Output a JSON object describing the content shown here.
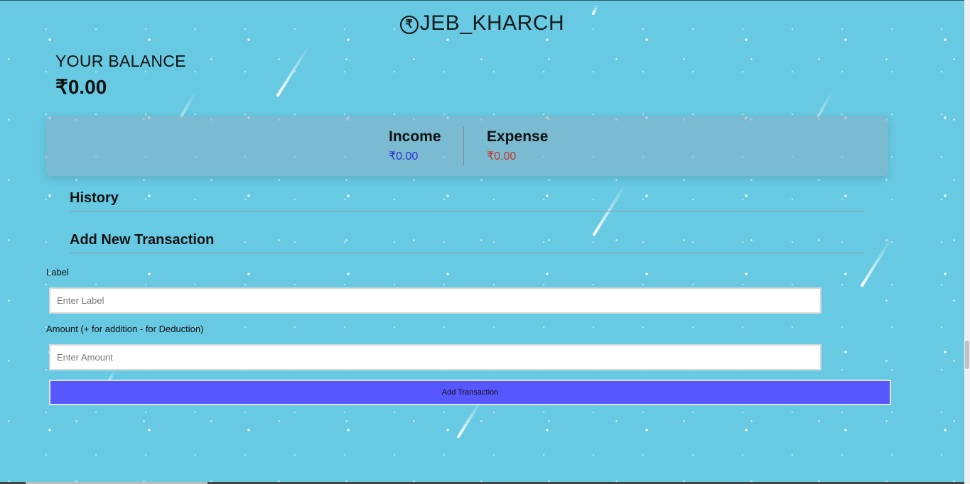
{
  "app": {
    "brand_icon": "₹",
    "brand_icon_name": "rupee-coin-icon",
    "title": "JEB_KHARCH"
  },
  "balance": {
    "label": "YOUR BALANCE",
    "value": "₹0.00"
  },
  "summary": {
    "income_label": "Income",
    "income_value": "₹0.00",
    "expense_label": "Expense",
    "expense_value": "₹0.00"
  },
  "sections": {
    "history": "History",
    "add_new": "Add New Transaction"
  },
  "form": {
    "label_field_label": "Label",
    "label_placeholder": "Enter Label",
    "amount_field_label": "Amount (+ for addition - for Deduction)",
    "amount_placeholder": "Enter Amount",
    "submit_label": "Add Transaction"
  },
  "colors": {
    "background": "#67c9e2",
    "income": "#2d2ed0",
    "expense": "#c2382e",
    "button": "#5757ff"
  }
}
